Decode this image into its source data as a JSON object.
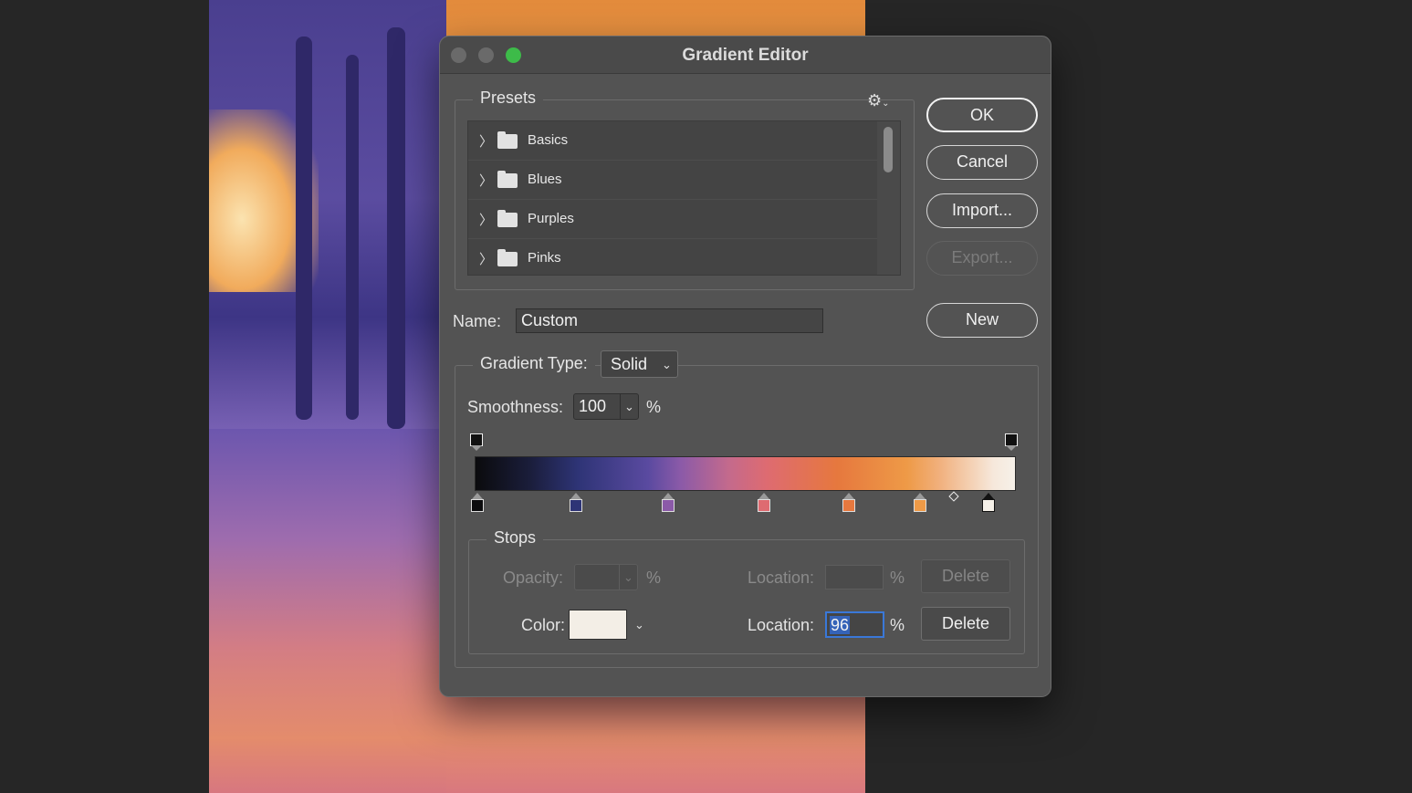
{
  "dialog": {
    "title": "Gradient Editor",
    "presets": {
      "legend": "Presets",
      "items": [
        {
          "label": "Basics"
        },
        {
          "label": "Blues"
        },
        {
          "label": "Purples"
        },
        {
          "label": "Pinks"
        }
      ]
    },
    "buttons": {
      "ok": "OK",
      "cancel": "Cancel",
      "import": "Import...",
      "export": "Export...",
      "new": "New"
    },
    "name": {
      "label": "Name:",
      "value": "Custom"
    },
    "gradient": {
      "type_label": "Gradient Type:",
      "type_value": "Solid",
      "smoothness_label": "Smoothness:",
      "smoothness_value": "100",
      "smoothness_unit": "%",
      "color_stops": [
        "#0b0b0d",
        "#2e3476",
        "#8b5aa8",
        "#de6b71",
        "#e6783e",
        "#ee9a47",
        "#f6f1e9"
      ],
      "selected_stop_location": 96
    },
    "stops": {
      "legend": "Stops",
      "opacity_label": "Opacity:",
      "opacity_unit": "%",
      "opacity_location_label": "Location:",
      "opacity_location_unit": "%",
      "opacity_delete": "Delete",
      "color_label": "Color:",
      "color_value": "#f3eee6",
      "color_location_label": "Location:",
      "color_location_value": "96",
      "color_location_unit": "%",
      "color_delete": "Delete"
    }
  }
}
